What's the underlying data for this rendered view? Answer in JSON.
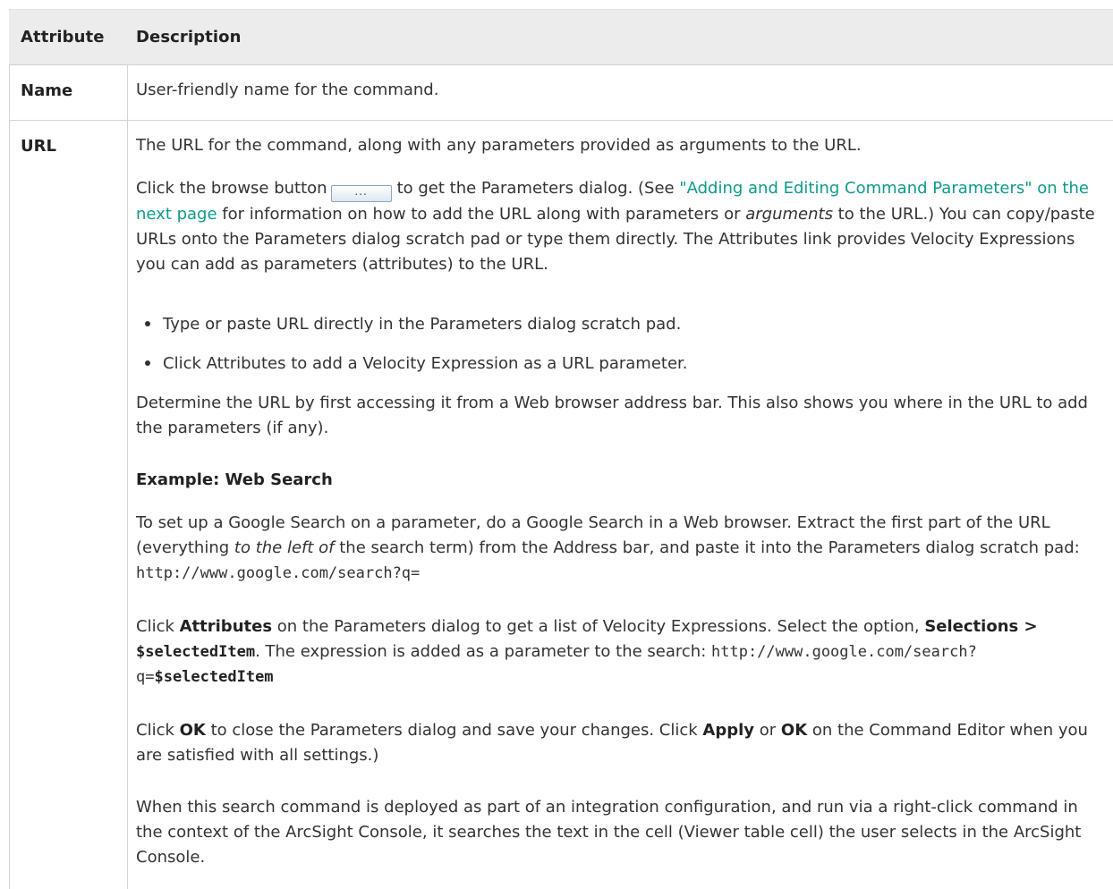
{
  "table": {
    "headers": {
      "attribute": "Attribute",
      "description": "Description"
    },
    "rows": [
      {
        "attribute": "Name",
        "description": "User-friendly name for the command."
      },
      {
        "attribute": "URL"
      }
    ]
  },
  "url": {
    "p1": "The URL for the command, along with any parameters provided as arguments to the URL.",
    "p2_pre": "Click the browse button",
    "browse_glyph": "...",
    "p2_mid": "to get the Parameters dialog. (See ",
    "p2_link": "\"Adding and Editing Command Parameters\" on the next page",
    "p2_post_a": " for information on how to add the URL along with parameters or ",
    "p2_em": "arguments",
    "p2_post_b": " to the URL.) You can copy/paste URLs onto the Parameters dialog scratch pad or type them directly. The Attributes link provides Velocity Expressions you can add as parameters (attributes) to the URL.",
    "bullets": [
      "Type or paste URL directly in the Parameters dialog scratch pad.",
      "Click Attributes to add a Velocity Expression as a URL parameter."
    ],
    "p3": "Determine the URL by first accessing it from a Web browser address bar. This also shows you where in the URL to add the parameters (if any).",
    "example_heading": "Example: Web Search",
    "p4_a": "To set up a Google Search on a parameter, do a Google Search in a Web browser. Extract the first part of the URL (everything ",
    "p4_em": "to the left of",
    "p4_b": " the search term) from the Address bar, and paste it into the Parameters dialog scratch pad: ",
    "p4_code": "http://www.google.com/search?q=",
    "p5_a": "Click ",
    "p5_attr": "Attributes",
    "p5_b": " on the Parameters dialog to get a list of Velocity Expressions. Select the option, ",
    "p5_sel": "Selections > ",
    "p5_var": "$selectedItem",
    "p5_c": ". The expression is added as a parameter to the search: ",
    "p5_code": "http://www.google.com/search?q=",
    "p5_code_var": "$selectedItem",
    "p6_a": "Click ",
    "p6_ok": "OK",
    "p6_b": " to close the Parameters dialog and save your changes. Click ",
    "p6_apply": "Apply",
    "p6_c": " or ",
    "p6_ok2": "OK",
    "p6_d": " on the Command Editor when you are satisfied with all settings.)",
    "p7": "When this search command is deployed as part of an integration configuration, and run via a right-click command in the context of the ArcSight Console, it searches the text in the cell (Viewer table cell) the user selects in the ArcSight Console."
  }
}
